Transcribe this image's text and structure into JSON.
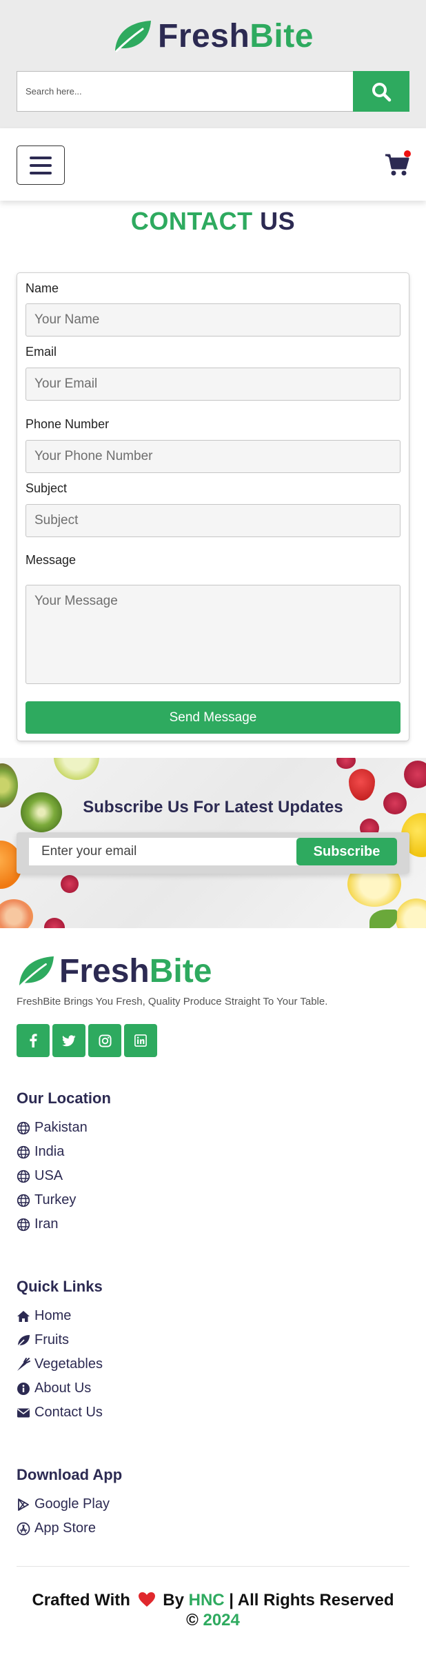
{
  "brand": {
    "name_part1": "Fresh",
    "name_part2": "Bite",
    "color_primary": "#2eaa5f",
    "color_dark": "#2c2a52"
  },
  "header": {
    "search_placeholder": "Search here...",
    "search_icon": "search-icon"
  },
  "nav": {
    "menu_icon": "hamburger-icon",
    "cart_icon": "cart-icon"
  },
  "contact": {
    "title_part1": "CONTACT",
    "title_part2": "US",
    "fields": {
      "name_label": "Name",
      "name_placeholder": "Your Name",
      "email_label": "Email",
      "email_placeholder": "Your Email",
      "phone_label": "Phone Number",
      "phone_placeholder": "Your Phone Number",
      "subject_label": "Subject",
      "subject_placeholder": "Subject",
      "message_label": "Message",
      "message_placeholder": "Your Message"
    },
    "submit_label": "Send Message"
  },
  "subscribe": {
    "title": "Subscribe Us For Latest Updates",
    "email_placeholder": "Enter your email",
    "button_label": "Subscribe"
  },
  "footer": {
    "tagline": "FreshBite Brings You Fresh, Quality Produce Straight To Your Table.",
    "socials": [
      "facebook-icon",
      "twitter-icon",
      "instagram-icon",
      "linkedin-icon"
    ],
    "location": {
      "heading": "Our Location",
      "items": [
        "Pakistan",
        "India",
        "USA",
        "Turkey",
        "Iran"
      ]
    },
    "quick_links": {
      "heading": "Quick Links",
      "items": [
        "Home",
        "Fruits",
        "Vegetables",
        "About Us",
        "Contact Us"
      ]
    },
    "download": {
      "heading": "Download App",
      "items": [
        "Google Play",
        "App Store"
      ]
    },
    "credit": {
      "crafted": "Crafted With",
      "by": "By",
      "author": "HNC",
      "rights": "| All Rights Reserved",
      "copyright": "©",
      "year": "2024"
    }
  }
}
